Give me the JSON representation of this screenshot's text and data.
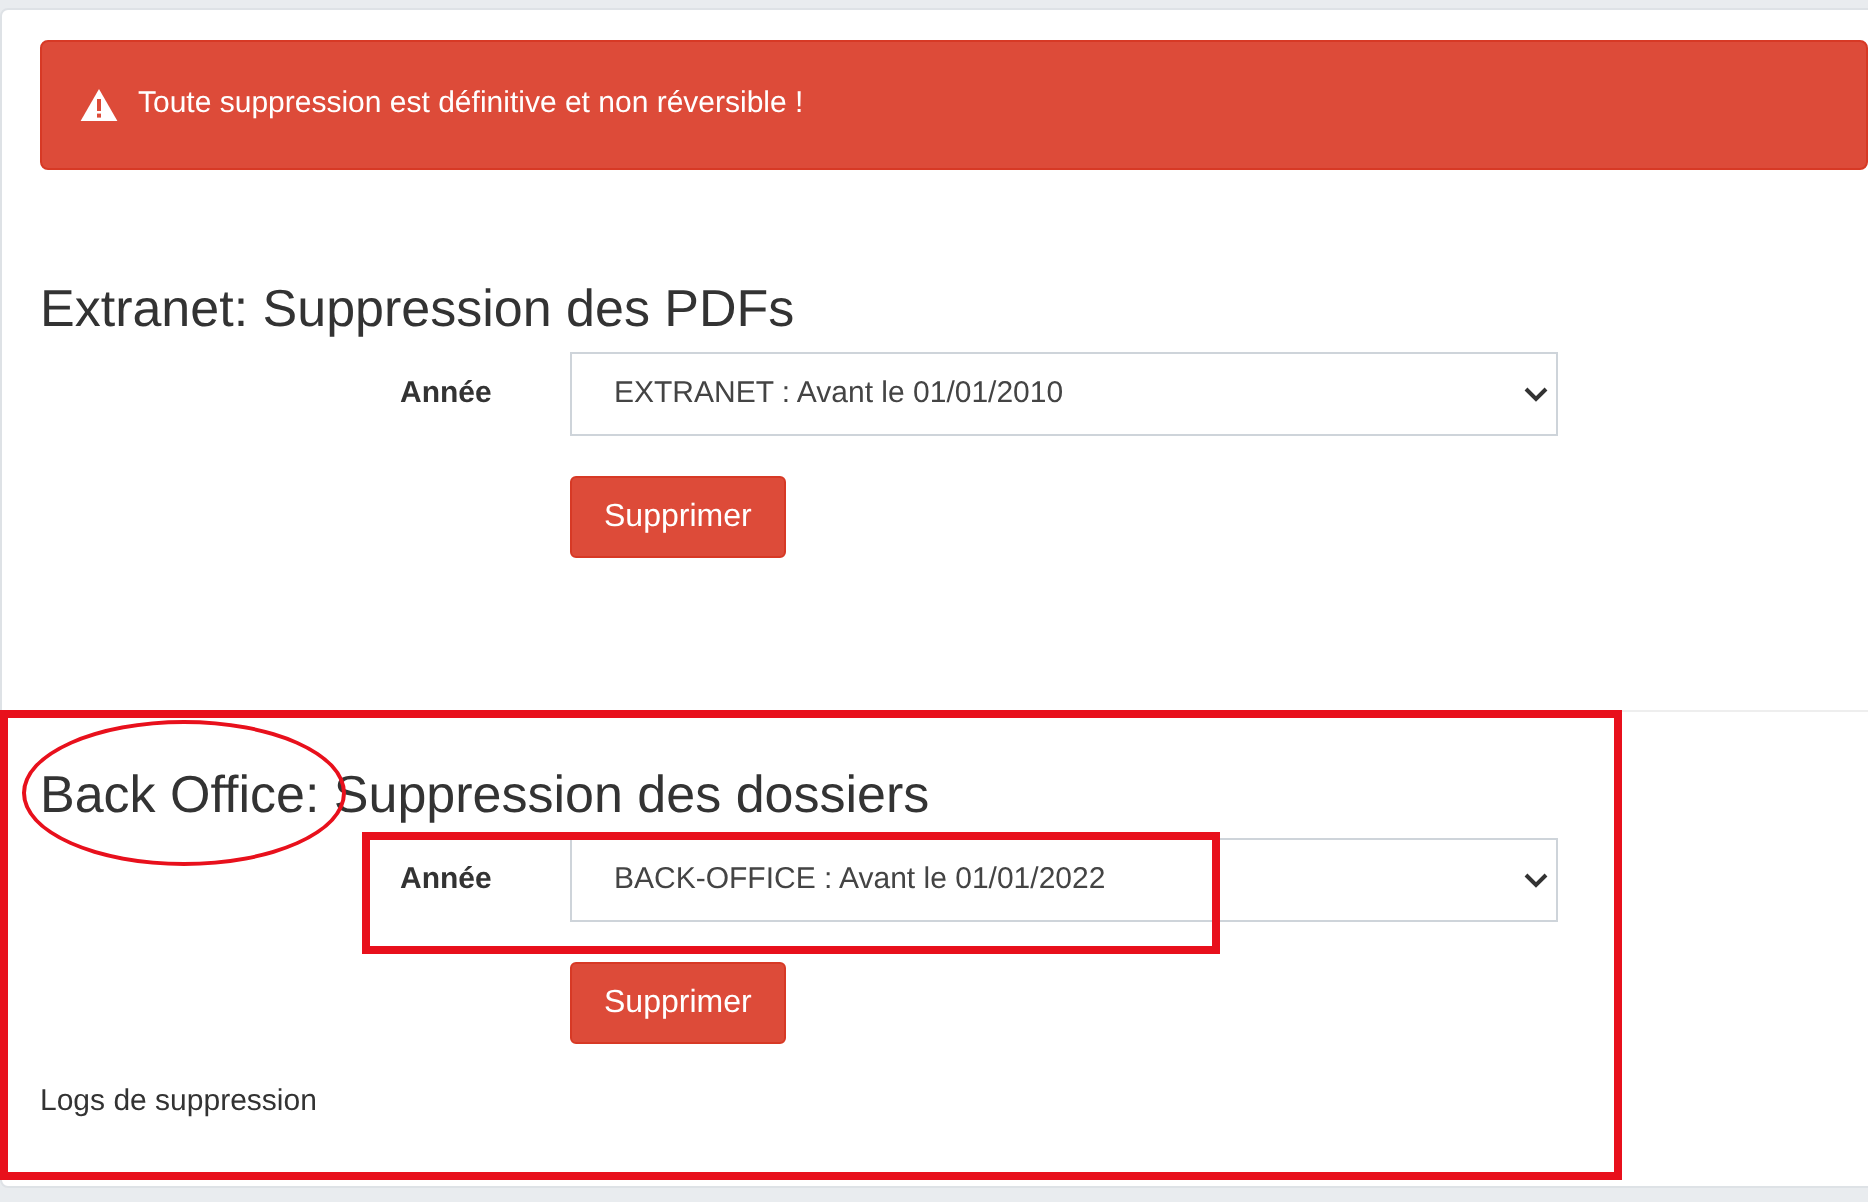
{
  "alert": {
    "text": "Toute suppression est définitive et non réversible !"
  },
  "sections": [
    {
      "title": "Extranet: Suppression des PDFs",
      "field_label": "Année",
      "select_value": "EXTRANET : Avant le 01/01/2010",
      "button": "Supprimer"
    },
    {
      "title": "Back Office: Suppression des dossiers",
      "field_label": "Année",
      "select_value": "BACK-OFFICE : Avant le 01/01/2022",
      "button": "Supprimer"
    }
  ],
  "logs_link": "Logs de suppression"
}
